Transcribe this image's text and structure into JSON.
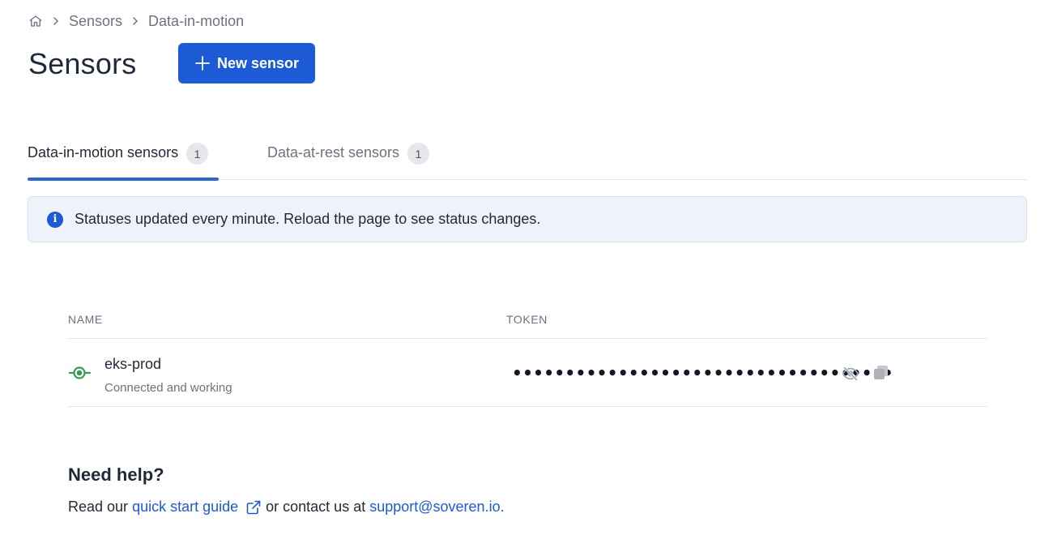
{
  "breadcrumb": {
    "home_icon": "home-icon",
    "items": [
      "Sensors",
      "Data-in-motion"
    ]
  },
  "header": {
    "title": "Sensors",
    "new_button_label": "New sensor"
  },
  "tabs": [
    {
      "label": "Data-in-motion sensors",
      "count": "1",
      "active": true
    },
    {
      "label": "Data-at-rest sensors",
      "count": "1",
      "active": false
    }
  ],
  "banner": {
    "icon": "info-icon",
    "text": "Statuses updated every minute. Reload the page to see status changes."
  },
  "table": {
    "columns": {
      "name": "NAME",
      "token": "TOKEN"
    },
    "rows": [
      {
        "name": "eks-prod",
        "status": "Connected and working",
        "token_masked": "••••••••••••••••••••••••••••••••••••",
        "status_color": "#3a9a4f"
      }
    ]
  },
  "help": {
    "title": "Need help?",
    "prefix": "Read our",
    "guide_link": "quick start guide",
    "middle": "or contact us at",
    "email": "support@soveren.io."
  },
  "colors": {
    "accent": "#1d5ad6",
    "tab_underline": "#2f66d6",
    "banner_bg": "#eef3fb"
  }
}
